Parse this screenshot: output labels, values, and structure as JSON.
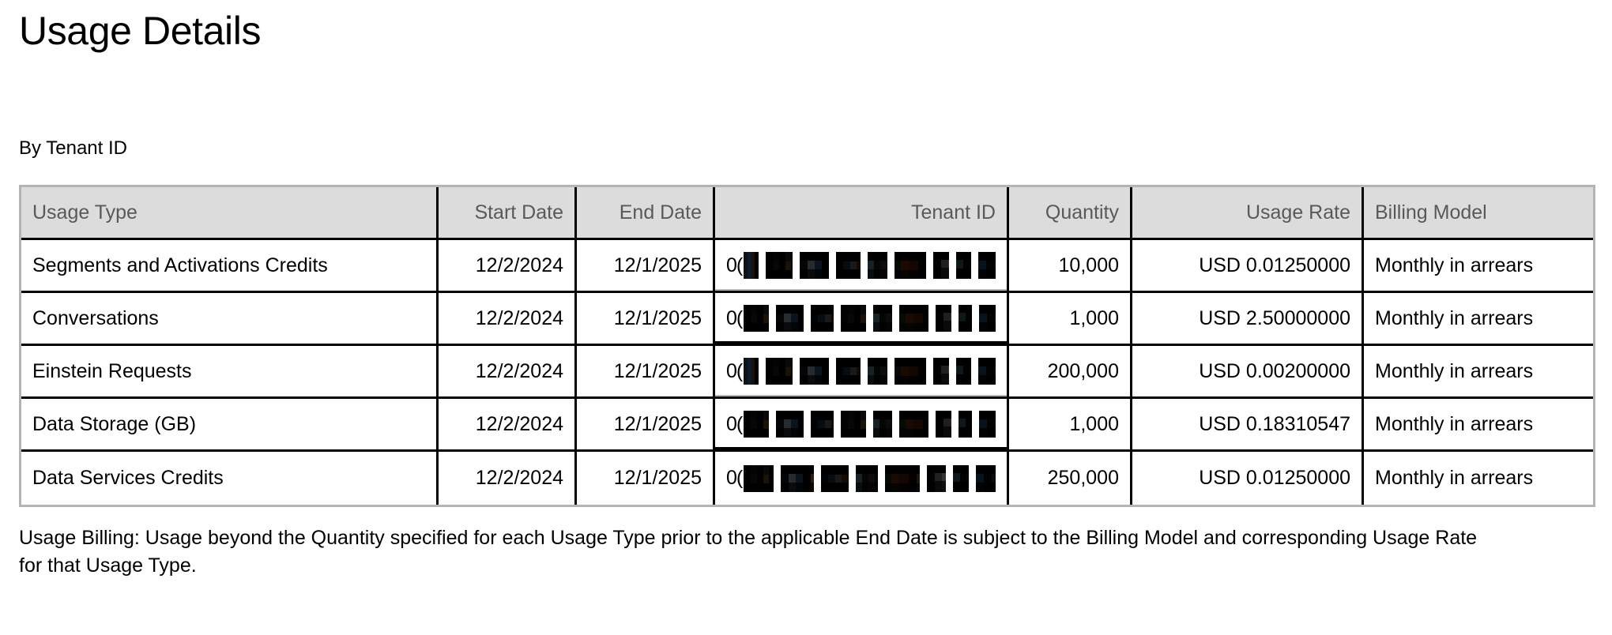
{
  "page": {
    "title": "Usage Details",
    "subtitle": "By Tenant ID"
  },
  "table": {
    "columns": [
      {
        "key": "usage_type",
        "label": "Usage Type",
        "align": "left"
      },
      {
        "key": "start_date",
        "label": "Start Date",
        "align": "right"
      },
      {
        "key": "end_date",
        "label": "End Date",
        "align": "right"
      },
      {
        "key": "tenant_id",
        "label": "Tenant ID",
        "align": "right"
      },
      {
        "key": "quantity",
        "label": "Quantity",
        "align": "right"
      },
      {
        "key": "usage_rate",
        "label": "Usage Rate",
        "align": "right"
      },
      {
        "key": "billing_model",
        "label": "Billing Model",
        "align": "left"
      }
    ],
    "header": {
      "usage_type": "Usage Type",
      "start_date": "Start Date",
      "end_date": "End Date",
      "tenant_id": "Tenant ID",
      "quantity": "Quantity",
      "usage_rate": "Usage Rate",
      "billing_model": "Billing Model"
    },
    "tenant_id_redacted": true,
    "tenant_id_visible_prefix": "0(",
    "rows": [
      {
        "usage_type": "Segments and Activations Credits",
        "start_date": "12/2/2024",
        "end_date": "12/1/2025",
        "tenant_id": "0(",
        "quantity": "10,000",
        "usage_rate": "USD 0.01250000",
        "billing_model": "Monthly in arrears"
      },
      {
        "usage_type": "Conversations",
        "start_date": "12/2/2024",
        "end_date": "12/1/2025",
        "tenant_id": "0(",
        "quantity": "1,000",
        "usage_rate": "USD 2.50000000",
        "billing_model": "Monthly in arrears"
      },
      {
        "usage_type": "Einstein Requests",
        "start_date": "12/2/2024",
        "end_date": "12/1/2025",
        "tenant_id": "0(",
        "quantity": "200,000",
        "usage_rate": "USD 0.00200000",
        "billing_model": "Monthly in arrears"
      },
      {
        "usage_type": "Data Storage (GB)",
        "start_date": "12/2/2024",
        "end_date": "12/1/2025",
        "tenant_id": "0(",
        "quantity": "1,000",
        "usage_rate": "USD 0.18310547",
        "billing_model": "Monthly in arrears"
      },
      {
        "usage_type": "Data Services Credits",
        "start_date": "12/2/2024",
        "end_date": "12/1/2025",
        "tenant_id": "0(",
        "quantity": "250,000",
        "usage_rate": "USD 0.01250000",
        "billing_model": "Monthly in arrears"
      }
    ]
  },
  "footnote": {
    "text": "Usage Billing: Usage beyond the Quantity specified for each Usage Type prior to the applicable End Date is subject to the Billing Model and corresponding Usage Rate for that Usage Type."
  },
  "colors": {
    "header_background": "#dcdcdc",
    "header_text": "#595959",
    "body_text": "#000000",
    "grid_line": "#000000",
    "table_outer_border": "#b4b4b4",
    "page_background": "#ffffff"
  }
}
